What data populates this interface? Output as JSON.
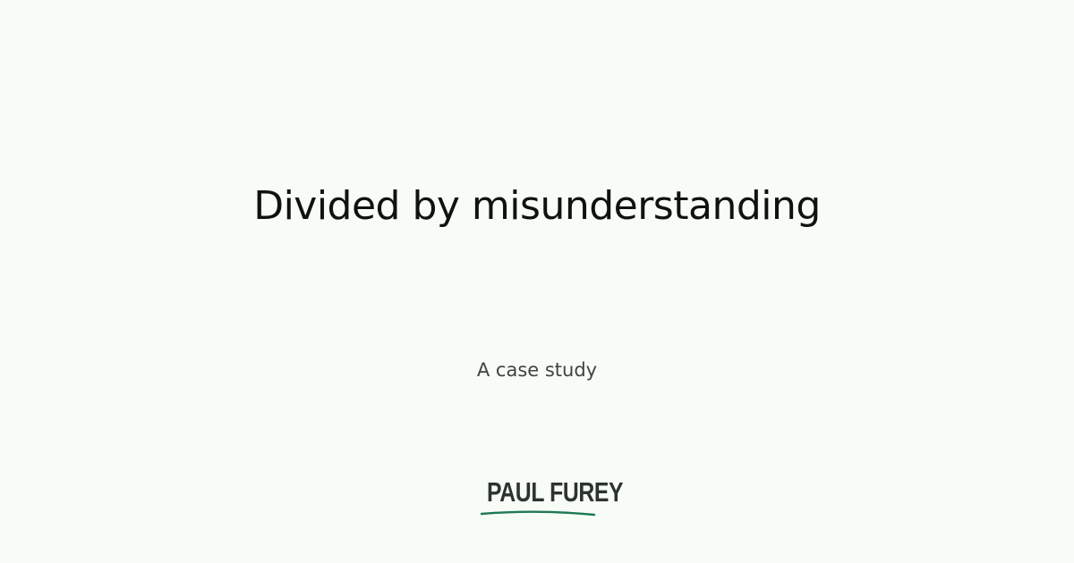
{
  "card": {
    "title": "Divided by misunderstanding",
    "subtitle": "A case study",
    "logo": {
      "text": "PAUL FUREY",
      "underline_color": "#1f7a52"
    },
    "background_color": "#f7fcf6"
  }
}
